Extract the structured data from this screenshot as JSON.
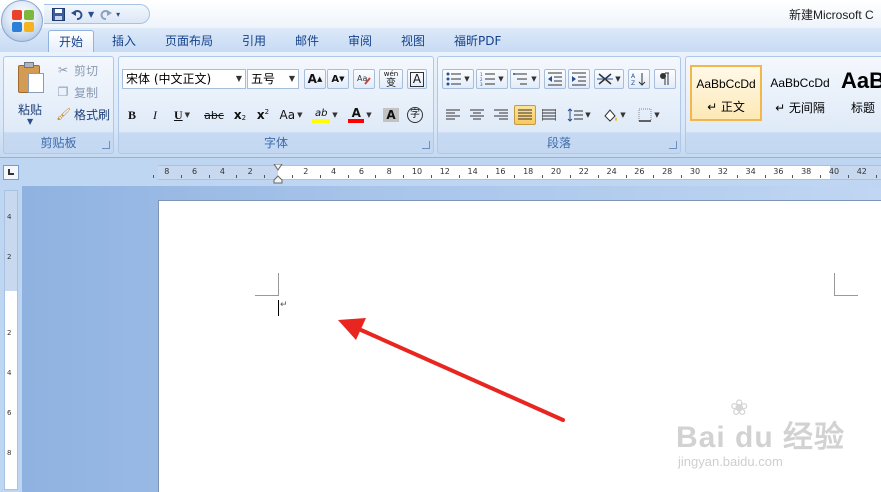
{
  "window": {
    "title": "新建Microsoft C"
  },
  "quick_access": {
    "save_icon": "save-icon",
    "undo_icon": "undo-icon",
    "redo_icon": "redo-icon",
    "customize_icon": "customize-qat-icon"
  },
  "tabs": [
    {
      "label": "开始",
      "active": true
    },
    {
      "label": "插入"
    },
    {
      "label": "页面布局"
    },
    {
      "label": "引用"
    },
    {
      "label": "邮件"
    },
    {
      "label": "审阅"
    },
    {
      "label": "视图"
    },
    {
      "label": "福昕PDF"
    }
  ],
  "clipboard": {
    "group_label": "剪贴板",
    "paste_label": "粘贴",
    "cut_label": "剪切",
    "copy_label": "复制",
    "format_painter_label": "格式刷"
  },
  "font": {
    "group_label": "字体",
    "font_name": "宋体 (中文正文)",
    "font_size": "五号",
    "grow_label": "A",
    "shrink_label": "A",
    "phonetic_label": "wén",
    "phonetic_char": "变",
    "border_char": "A",
    "bold": "B",
    "italic": "I",
    "underline": "U",
    "strikethrough": "abc",
    "subscript": "x",
    "superscript": "x",
    "change_case": "Aa",
    "highlight": "ab",
    "font_color": "A",
    "shading": "A",
    "enclose": "字"
  },
  "paragraph": {
    "group_label": "段落"
  },
  "styles": [
    {
      "sample": "AaBbCcDd",
      "name": "↵ 正文",
      "selected": true
    },
    {
      "sample": "AaBbCcDd",
      "name": "↵ 无间隔"
    },
    {
      "sample": "AaB",
      "name": "标题"
    }
  ],
  "ruler": {
    "labels": [
      "8",
      "6",
      "4",
      "2",
      "2",
      "4",
      "6",
      "8",
      "10",
      "12",
      "14",
      "16",
      "18",
      "20",
      "22",
      "24",
      "26",
      "28",
      "30",
      "32",
      "34",
      "36",
      "38",
      "40",
      "42"
    ],
    "vertical_labels": [
      "4",
      "2",
      "2",
      "4",
      "6",
      "8"
    ]
  },
  "document": {
    "paragraph_mark": "↵"
  },
  "annotation": {
    "arrow_color": "#e8261f"
  },
  "watermark": {
    "brand": "Bai du 经验",
    "url": "jingyan.baidu.com"
  },
  "colors": {
    "ribbon_text": "#15428b",
    "highlight": "#ffff00",
    "font_color_bar": "#ff0000"
  }
}
